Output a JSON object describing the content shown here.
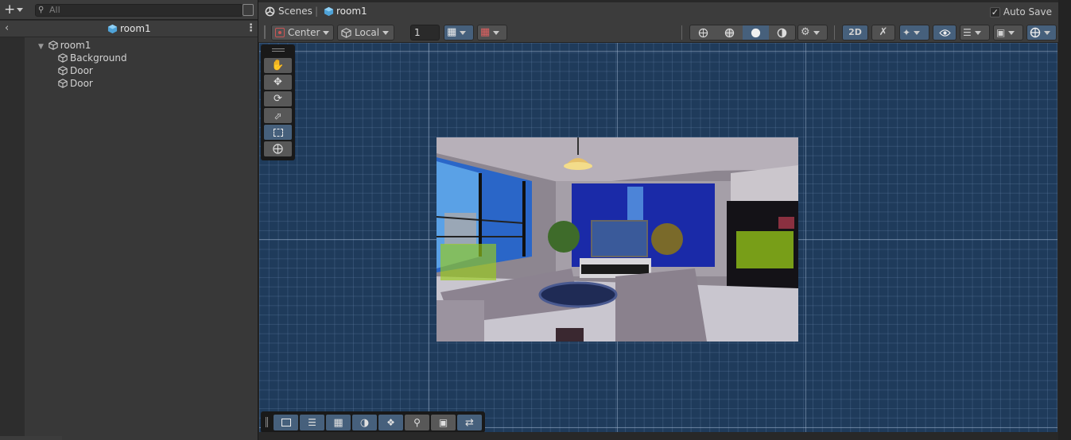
{
  "hierarchy": {
    "search_placeholder": "All",
    "scene_name": "room1",
    "items": [
      {
        "label": "room1"
      },
      {
        "label": "Background"
      },
      {
        "label": "Door"
      },
      {
        "label": "Door"
      }
    ]
  },
  "scene": {
    "breadcrumb_root": "Scenes",
    "breadcrumb_scene": "room1",
    "auto_save_label": "Auto Save",
    "auto_save_checked": true,
    "pivot_label": "Center",
    "space_label": "Local",
    "grid_size_value": "1",
    "mode_2d_label": "2D"
  },
  "colors": {
    "accent": "#46607c",
    "viewport_bg": "#1f3b5b",
    "panel_bg": "#383838",
    "trigger_zone": "#9acd1a"
  },
  "icons": {
    "tools": [
      "hand-icon",
      "move-icon",
      "rotate-icon",
      "scale-icon",
      "rect-icon",
      "transform-icon"
    ],
    "overlay": [
      "rect-icon",
      "sliders-icon",
      "grid-icon",
      "shading-icon",
      "layers-icon",
      "search-icon",
      "camera-icon",
      "shuffle-icon"
    ]
  }
}
